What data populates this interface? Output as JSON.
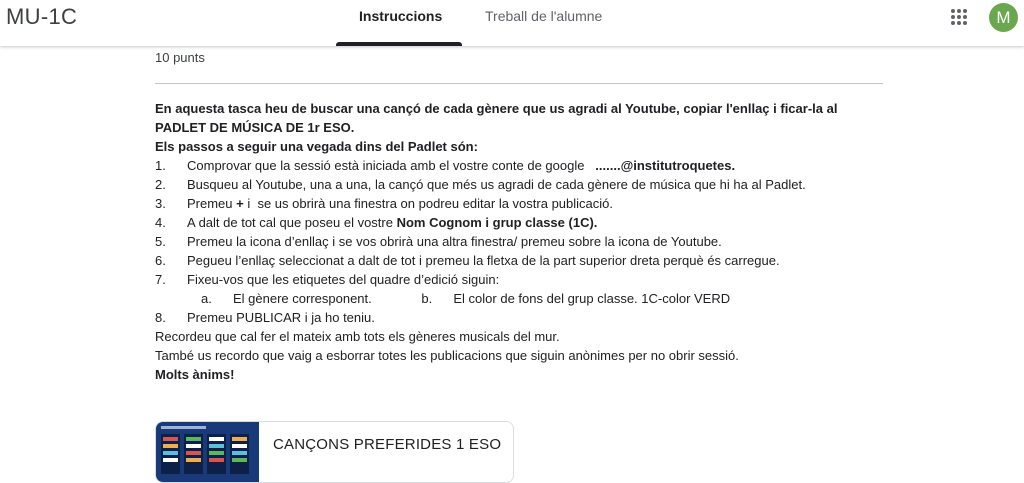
{
  "header": {
    "course_title": "MU-1C",
    "tabs": [
      {
        "label": "Instruccions",
        "active": true
      },
      {
        "label": "Treball de l'alumne",
        "active": false
      }
    ],
    "avatar_letter": "M",
    "avatar_color": "#6aa84f",
    "apps_icon": "apps-grid-icon"
  },
  "assignment": {
    "points": "10 punts",
    "intro_bold": "En aquesta tasca heu de buscar una cançó de cada gènere que us agradi al Youtube, copiar l'enllaç i ficar-la al",
    "intro_bold_2": "PADLET DE MÚSICA DE 1r ESO.",
    "steps_heading": "Els passos a seguir una vegada dins del Padlet són:",
    "steps": [
      {
        "n": "1.",
        "text": "Comprovar que la sessió està iniciada amb el vostre conte de google",
        "strong": "   .......@institutroquetes."
      },
      {
        "n": "2.",
        "text": "Busqueu al Youtube, una a una, la cançó que més us agradi de cada gènere de música que hi ha al Padlet."
      },
      {
        "n": "3.",
        "text_pre": "Premeu ",
        "strong": "+",
        "text_post": " i  se us obrirà una finestra on podreu editar la vostra publicació."
      },
      {
        "n": "4.",
        "text": "A dalt de tot cal que poseu el vostre ",
        "strong": "Nom Cognom i grup classe (1C)."
      },
      {
        "n": "5.",
        "text": "Premeu la icona d’enllaç i se vos obrirà una altra finestra/ premeu sobre la icona de Youtube."
      },
      {
        "n": "6.",
        "text": "Pegueu l’enllaç seleccionat a dalt de tot i premeu la fletxa de la part superior dreta perquè és carregue."
      },
      {
        "n": "7.",
        "text": "Fixeu-vos que les etiquetes del quadre d’edició siguin:"
      }
    ],
    "substeps": [
      {
        "n": "a.",
        "text": "El gènere corresponent."
      },
      {
        "n": "b.",
        "text": "El color de fons del grup classe. 1C-color VERD"
      }
    ],
    "step8": {
      "n": "8.",
      "text": "Premeu PUBLICAR i ja ho teniu."
    },
    "outro_1": "Recordeu que cal fer el mateix amb tots els gèneres musicals del mur.",
    "outro_2": "També us recordo que vaig a esborrar totes les publicacions que siguin anònimes per no obrir sessió.",
    "outro_bold": "Molts ànims!"
  },
  "attachment": {
    "title": "CANÇONS PREFERIDES 1 ESO"
  }
}
